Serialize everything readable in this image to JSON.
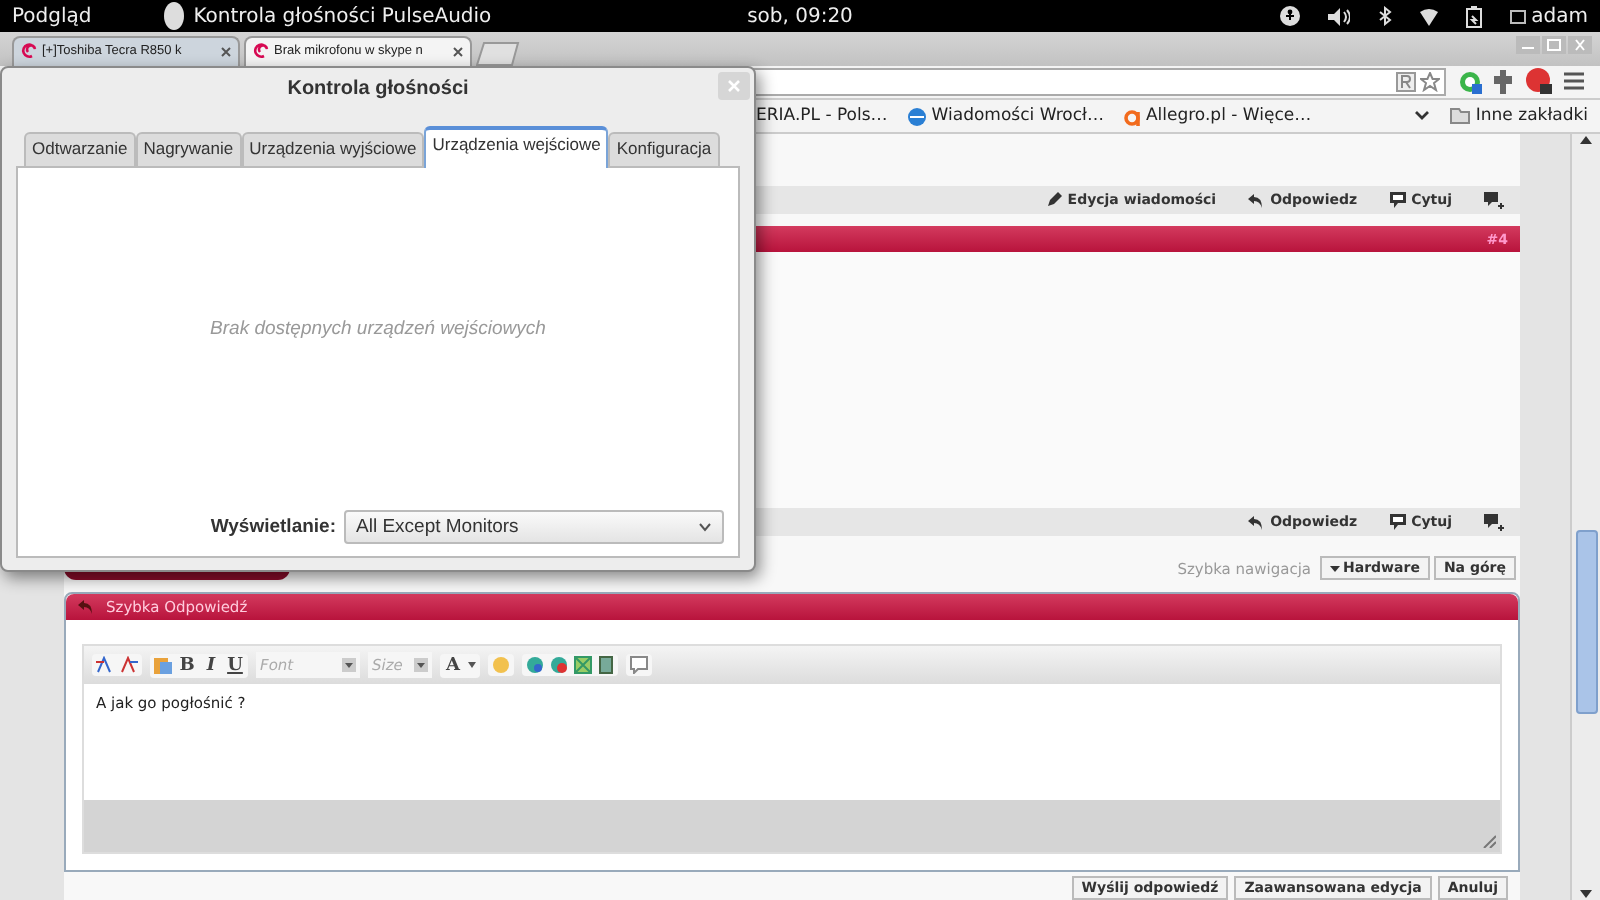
{
  "top_bar": {
    "activities": "Podgląd",
    "app_name": "Kontrola głośności PulseAudio",
    "clock": "sob, 09:20",
    "user": "adam"
  },
  "browser": {
    "tabs": [
      {
        "title": "[+]Toshiba Tecra R850 k",
        "selected": false
      },
      {
        "title": "Brak mikrofonu w skype n",
        "selected": true
      }
    ],
    "bookmarks": [
      {
        "label": "ERIA.PL - Pols…",
        "kind": "plain"
      },
      {
        "label": "Wiadomości Wrocł…",
        "kind": "globe"
      },
      {
        "label": "Allegro.pl - Więce…",
        "kind": "letter"
      }
    ],
    "other_bookmarks": "Inne zakładki"
  },
  "post": {
    "top_actions": [
      {
        "label": "Edycja wiadomości",
        "kind": "edit"
      },
      {
        "label": "Odpowiedz",
        "kind": "reply"
      },
      {
        "label": "Cytuj",
        "kind": "quote"
      }
    ],
    "number": "#4",
    "bottom_actions": [
      {
        "label": "Odpowiedz",
        "kind": "reply"
      },
      {
        "label": "Cytuj",
        "kind": "quote"
      }
    ]
  },
  "navigation": {
    "label": "Szybka nawigacja",
    "forum_button": "Hardware",
    "top_button": "Na górę"
  },
  "quick_reply": {
    "title": "Szybka Odpowiedź",
    "format_buttons": [
      "B",
      "I",
      "U"
    ],
    "font_placeholder": "Font",
    "size_placeholder": "Size",
    "color_button": "A",
    "text": "A jak go pogłośnić ?",
    "buttons": [
      "Wyślij odpowiedź",
      "Zaawansowana edycja",
      "Anuluj"
    ]
  },
  "dialog": {
    "title": "Kontrola głośności",
    "tabs": [
      {
        "label": "Odtwarzanie",
        "selected": false
      },
      {
        "label": "Nagrywanie",
        "selected": false
      },
      {
        "label": "Urządzenia wyjściowe",
        "selected": false
      },
      {
        "label": "Urządzenia wejściowe",
        "selected": true
      },
      {
        "label": "Konfiguracja",
        "selected": false
      }
    ],
    "empty_message": "Brak dostępnych urządzeń wejściowych",
    "display_label": "Wyświetlanie:",
    "display_value": "All Except Monitors"
  }
}
